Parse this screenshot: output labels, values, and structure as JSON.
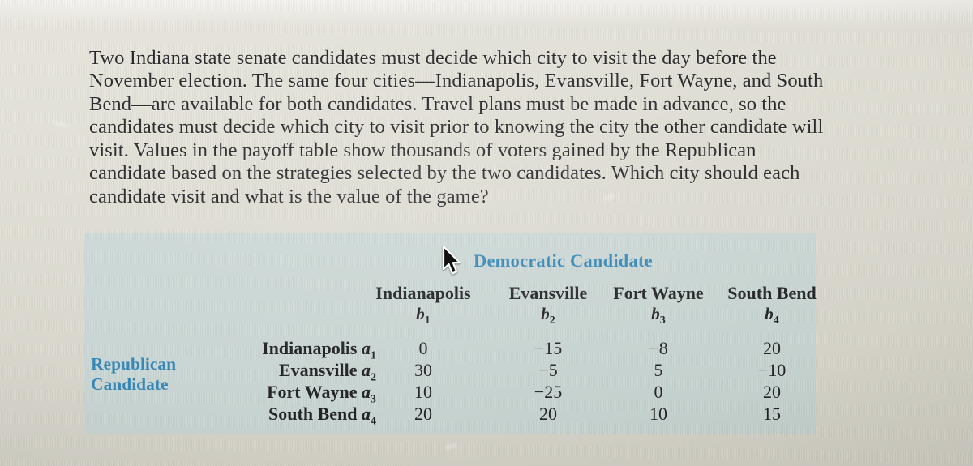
{
  "problem": {
    "text": "Two Indiana state senate candidates must decide which city to visit the day before the November election. The same four cities—Indianapolis, Evansville, Fort Wayne, and South Bend—are available for both candidates. Travel plans must be made in advance, so the candidates must decide which city to visit prior to knowing the city the other candidate will visit. Values in the payoff table show thousands of voters gained by the Republican candidate based on the strategies selected by the two candidates. Which city should each candidate visit and what is the value of the game?"
  },
  "payoff_table": {
    "column_player_label": "Democratic Candidate",
    "row_player_label_line1": "Republican",
    "row_player_label_line2": "Candidate",
    "column_headers": [
      {
        "city": "Indianapolis",
        "strategy": "b",
        "index": "1"
      },
      {
        "city": "Evansville",
        "strategy": "b",
        "index": "2"
      },
      {
        "city": "Fort Wayne",
        "strategy": "b",
        "index": "3"
      },
      {
        "city": "South Bend",
        "strategy": "b",
        "index": "4"
      }
    ],
    "row_headers": [
      {
        "city": "Indianapolis",
        "strategy": "a",
        "index": "1"
      },
      {
        "city": "Evansville",
        "strategy": "a",
        "index": "2"
      },
      {
        "city": "Fort Wayne",
        "strategy": "a",
        "index": "3"
      },
      {
        "city": "South Bend",
        "strategy": "a",
        "index": "4"
      }
    ],
    "values": [
      [
        "0",
        "−15",
        "−8",
        "20"
      ],
      [
        "30",
        "−5",
        "5",
        "−10"
      ],
      [
        "10",
        "−25",
        "0",
        "20"
      ],
      [
        "20",
        "20",
        "10",
        "15"
      ]
    ]
  },
  "cursor": {
    "icon": "mouse-pointer-icon"
  },
  "colors": {
    "accent_blue": "#2b82b4",
    "panel_background": "#c9d6d3",
    "page_background": "#e0ded4",
    "text": "#16161a"
  }
}
